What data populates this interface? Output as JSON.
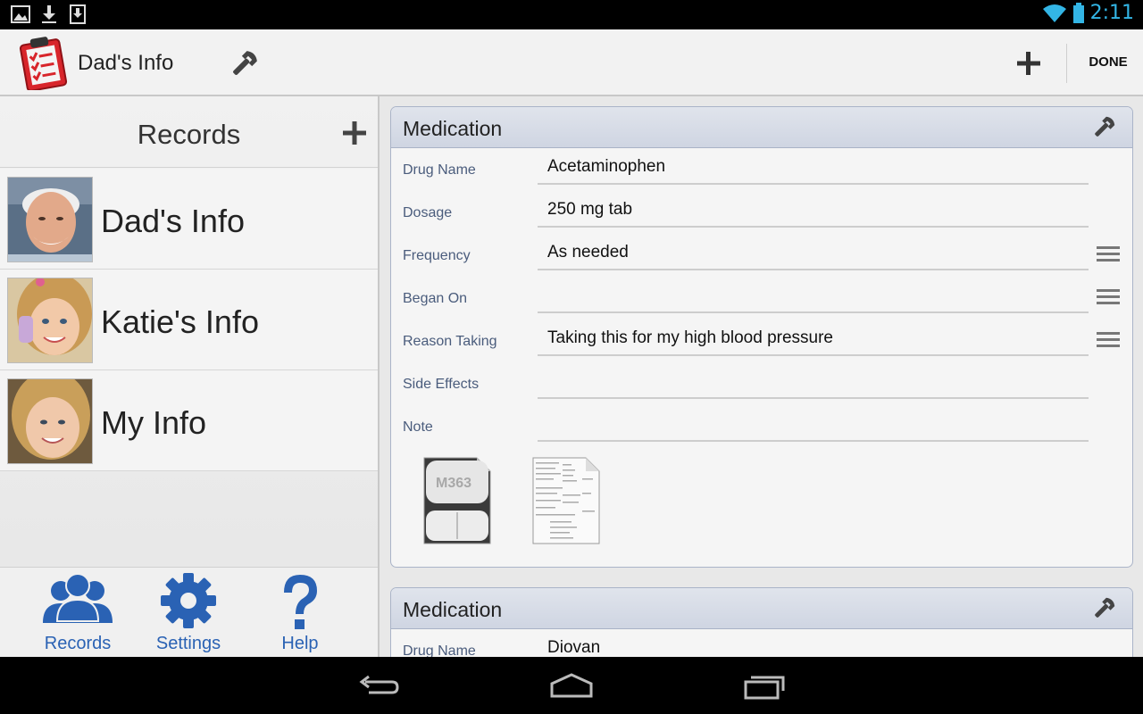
{
  "status_bar": {
    "time": "2:11"
  },
  "action_bar": {
    "title": "Dad's Info",
    "done_label": "DONE"
  },
  "records": {
    "title": "Records",
    "items": [
      {
        "name": "Dad's Info"
      },
      {
        "name": "Katie's Info"
      },
      {
        "name": "My Info"
      }
    ]
  },
  "bottom_nav": {
    "records": "Records",
    "settings": "Settings",
    "help": "Help"
  },
  "medications": [
    {
      "title": "Medication",
      "fields": [
        {
          "label": "Drug Name",
          "value": "Acetaminophen"
        },
        {
          "label": "Dosage",
          "value": "250 mg tab"
        },
        {
          "label": "Frequency",
          "value": "As needed"
        },
        {
          "label": "Began On",
          "value": ""
        },
        {
          "label": "Reason Taking",
          "value": "Taking this for my high blood pressure"
        },
        {
          "label": "Side Effects",
          "value": ""
        },
        {
          "label": "Note",
          "value": ""
        }
      ],
      "pill_imprint": "M363"
    },
    {
      "title": "Medication",
      "fields": [
        {
          "label": "Drug Name",
          "value": "Diovan"
        }
      ]
    }
  ],
  "colors": {
    "accent_blue": "#2a62b4",
    "clock_blue": "#33b5e5",
    "label_blue_gray": "#4a5c7c"
  }
}
